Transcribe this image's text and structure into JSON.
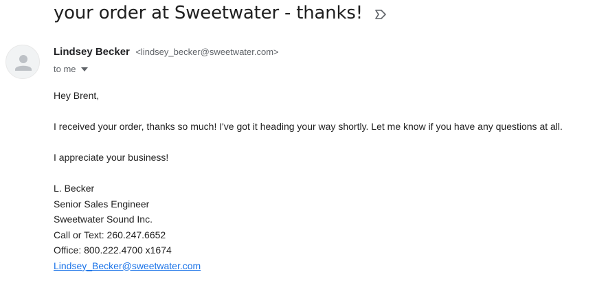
{
  "subject": "your order at Sweetwater - thanks!",
  "label_icon": "label-arrow-icon",
  "sender": {
    "avatar_icon": "person-icon",
    "name": "Lindsey Becker",
    "email": "<lindsey_becker@sweetwater.com>",
    "recipient": "to me",
    "dropdown_icon": "caret-down-icon"
  },
  "message": {
    "greeting": "Hey Brent,",
    "paragraph1": "I received your order, thanks so much! I've got it heading your way shortly. Let me know if you have any questions at all.",
    "paragraph2": "I appreciate your business!",
    "signature": {
      "name": "L. Becker",
      "title": "Senior Sales Engineer",
      "company": "Sweetwater Sound Inc.",
      "phone": "Call or Text: 260.247.6652",
      "office": "Office: 800.222.4700 x1674",
      "email_link": "Lindsey_Becker@sweetwater.com"
    }
  },
  "colors": {
    "link": "#1a73e8",
    "muted": "#5f6368",
    "text": "#222222"
  }
}
